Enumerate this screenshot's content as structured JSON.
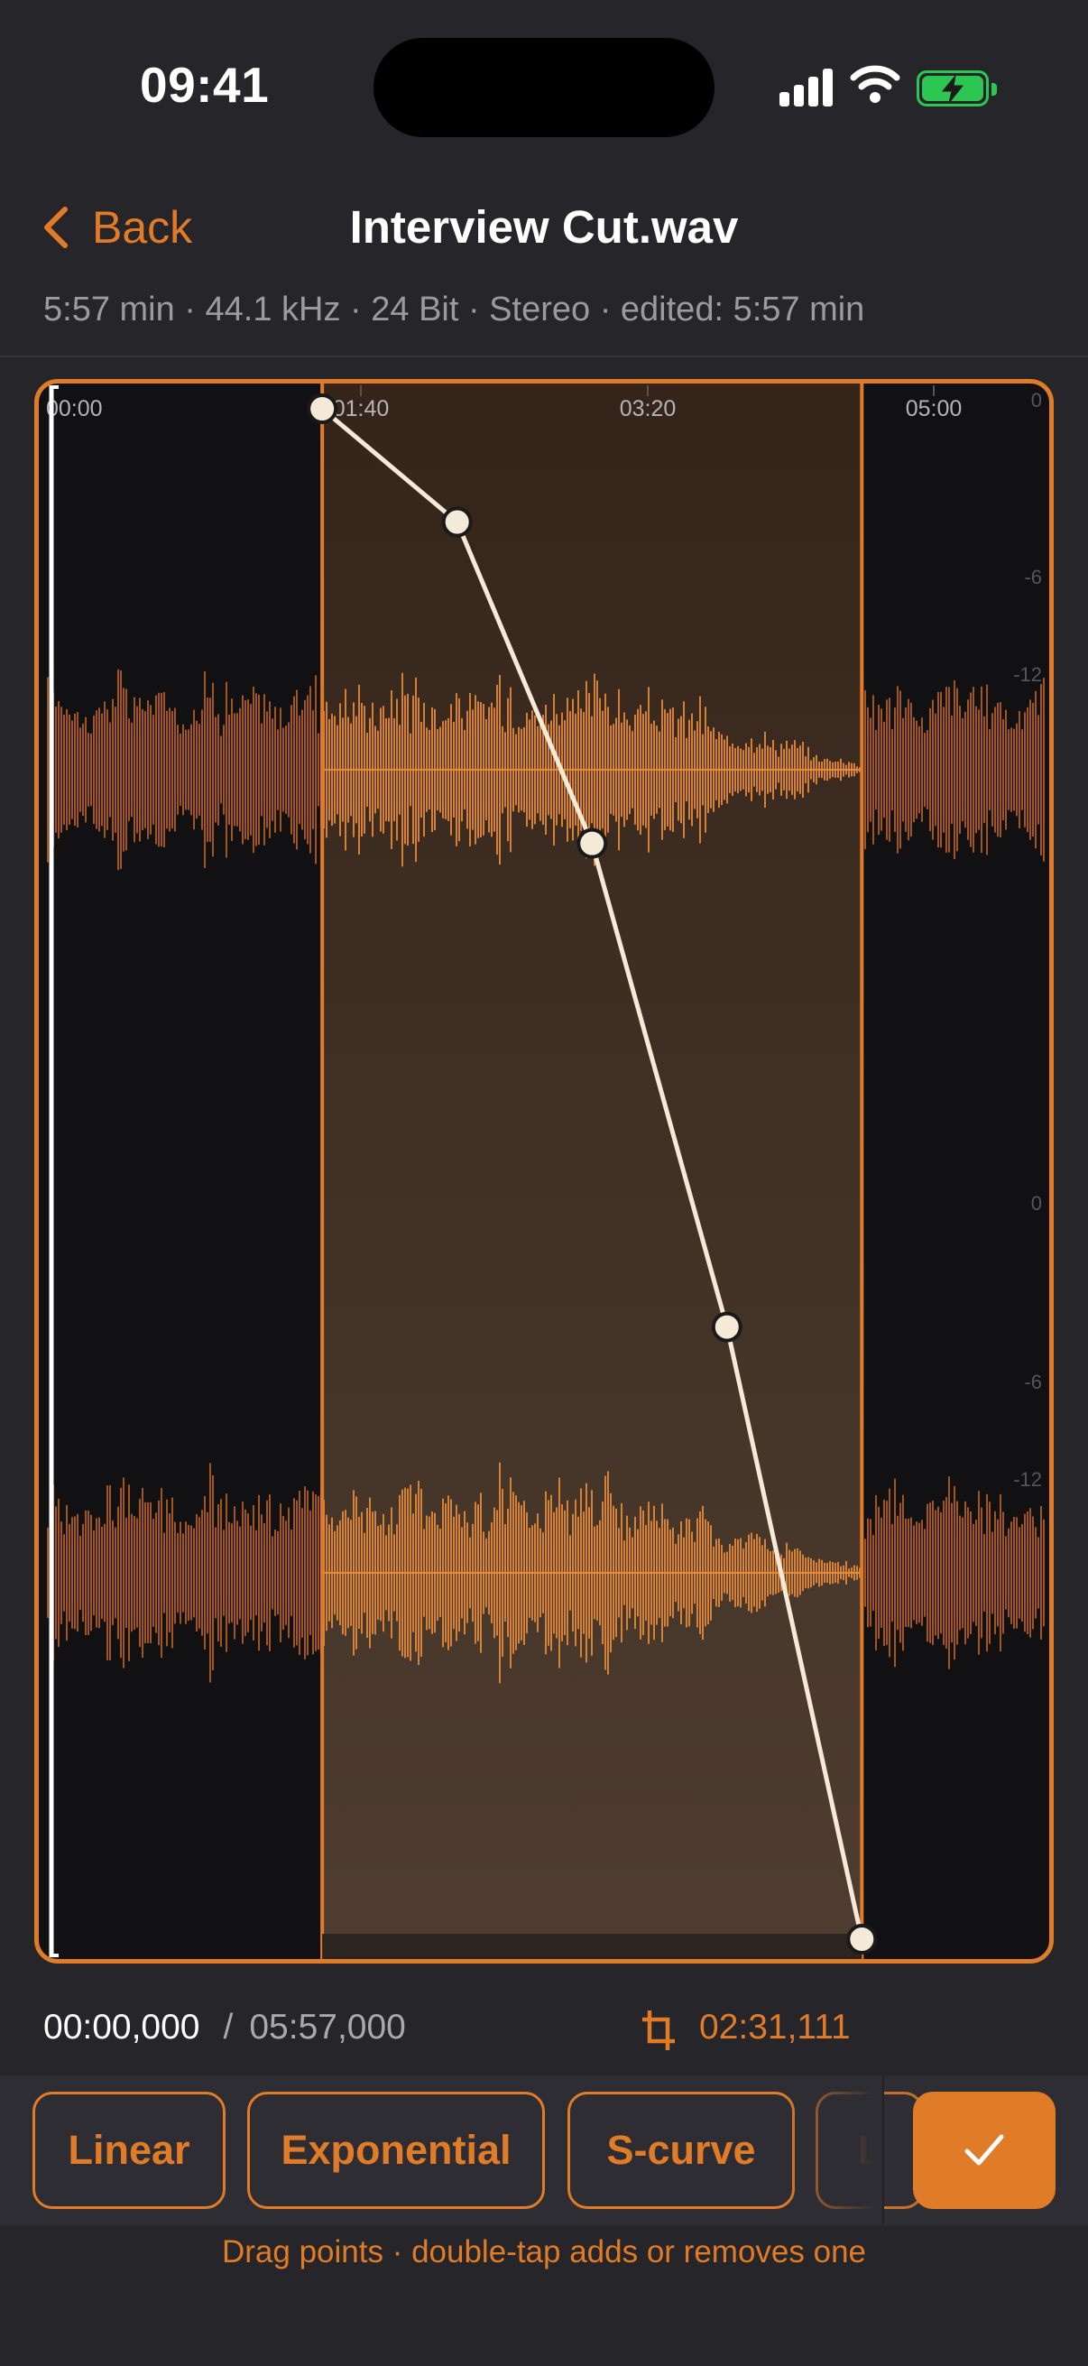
{
  "status_bar": {
    "time": "09:41",
    "signal_icon": "cellular-signal-icon",
    "wifi_icon": "wifi-icon",
    "battery_icon": "battery-charging-icon",
    "battery_color": "#2dc653"
  },
  "nav": {
    "back_label": "Back",
    "title": "Interview Cut.wav"
  },
  "file_meta": "5:57 min · 44.1 kHz · 24 Bit · Stereo · edited: 5:57 min",
  "timeline": {
    "ticks": [
      "00:00",
      "01:40",
      "03:20",
      "05:00"
    ]
  },
  "db_scale": {
    "top_channel": [
      "0",
      "-6",
      "-12"
    ],
    "bottom_channel": [
      "0",
      "-6",
      "-12"
    ]
  },
  "fade": {
    "selection_start_s": 100,
    "selection_end_s": 291,
    "total_s": 357,
    "curve_points": [
      {
        "t": 0.0,
        "gain": 1.0
      },
      {
        "t": 0.25,
        "gain": 0.926
      },
      {
        "t": 0.5,
        "gain": 0.716
      },
      {
        "t": 0.75,
        "gain": 0.4
      },
      {
        "t": 1.0,
        "gain": 0.0
      }
    ]
  },
  "transport": {
    "position": "00:00,000",
    "separator": "/",
    "duration": "05:57,000",
    "selection_length": "02:31,111"
  },
  "presets": [
    {
      "label": "Linear"
    },
    {
      "label": "Exponential"
    },
    {
      "label": "S-curve"
    },
    {
      "label": "L"
    }
  ],
  "confirm_icon": "checkmark-icon",
  "hint": "Drag points · double-tap adds or removes one",
  "colors": {
    "accent": "#e07b27",
    "background": "#25252a",
    "editor_background": "#111114",
    "selection_fill": "#3a2a1d",
    "muted_text": "#9a9aa0"
  }
}
